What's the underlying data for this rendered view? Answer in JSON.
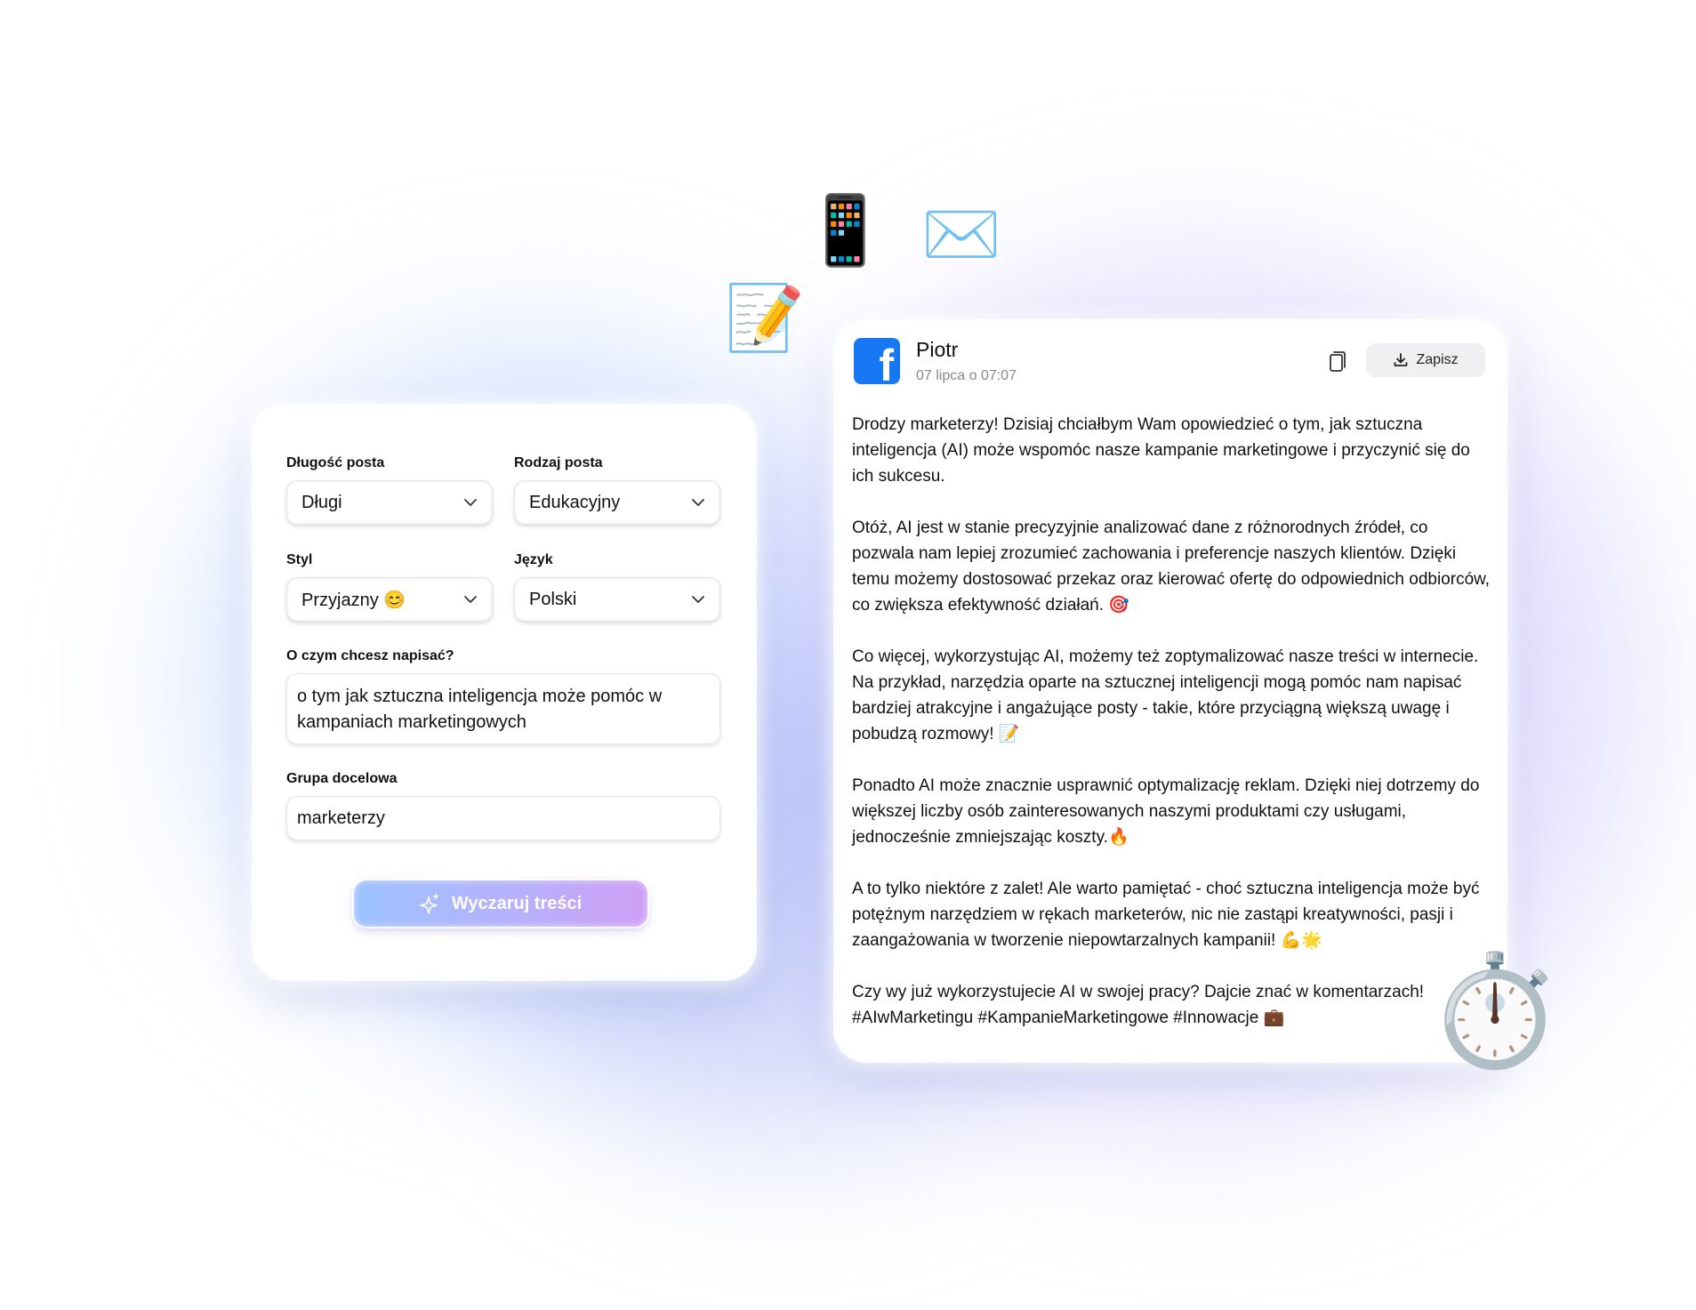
{
  "form": {
    "length_label": "Długość posta",
    "length_value": "Długi",
    "type_label": "Rodzaj posta",
    "type_value": "Edukacyjny",
    "style_label": "Styl",
    "style_value": "Przyjazny 😊",
    "language_label": "Język",
    "language_value": "Polski",
    "topic_label": "O czym chcesz napisać?",
    "topic_value": "o tym jak sztuczna inteligencja może pomóc w kampaniach marketingowych",
    "audience_label": "Grupa docelowa",
    "audience_value": "marketerzy",
    "generate_label": "Wyczaruj treści"
  },
  "post": {
    "platform_icon": "facebook-logo",
    "author": "Piotr",
    "date": "07 lipca o 07:07",
    "save_label": "Zapisz",
    "paragraphs": [
      "Drodzy marketerzy! Dzisiaj chciałbym Wam opowiedzieć o tym, jak sztuczna inteligencja (AI) może wspomóc nasze kampanie marketingowe i przyczynić się do ich sukcesu.",
      "Otóż, AI jest w stanie precyzyjnie analizować dane z różnorodnych źródeł, co pozwala nam lepiej zrozumieć zachowania i preferencje naszych klientów. Dzięki temu możemy dostosować przekaz oraz kierować ofertę do odpowiednich odbiorców, co zwiększa efektywność działań. 🎯",
      "Co więcej, wykorzystując AI, możemy też zoptymalizować nasze treści w internecie. Na przykład, narzędzia oparte na sztucznej inteligencji mogą pomóc nam napisać bardziej atrakcyjne i angażujące posty - takie, które przyciągną większą uwagę i pobudzą rozmowy! 📝",
      "Ponadto AI może znacznie usprawnić optymalizację reklam. Dzięki niej dotrzemy do większej liczby osób zainteresowanych naszymi produktami czy usługami, jednocześnie zmniejszając koszty.🔥",
      "A to tylko niektóre z zalet! Ale warto pamiętać - choć sztuczna inteligencja może być potężnym narzędziem w rękach marketerów, nic nie zastąpi kreatywności, pasji i zaangażowania w tworzenie niepowtarzalnych kampanii! 💪🌟",
      "Czy wy już wykorzystujecie AI w swojej pracy? Dajcie znać w komentarzach! #AIwMarketingu #KampanieMarketingowe #Innowacje 💼"
    ]
  },
  "decorations": {
    "phone_icon": "📱",
    "envelope_icon": "✉️",
    "memo_icon": "📝",
    "stopwatch_icon": "⏱️"
  }
}
